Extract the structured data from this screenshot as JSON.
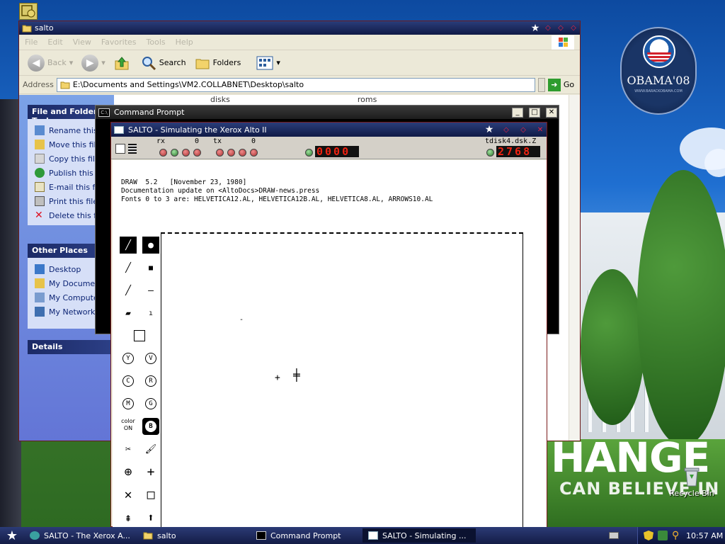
{
  "explorer": {
    "title": "salto",
    "menu": [
      "File",
      "Edit",
      "View",
      "Favorites",
      "Tools",
      "Help"
    ],
    "toolbar": {
      "back": "Back",
      "search": "Search",
      "folders": "Folders"
    },
    "address_label": "Address",
    "address_value": "E:\\Documents and Settings\\VM2.COLLABNET\\Desktop\\salto",
    "go_label": "Go",
    "file_tasks": {
      "header": "File and Folder Tasks",
      "items": [
        "Rename this file",
        "Move this file",
        "Copy this file",
        "Publish this file",
        "E-mail this file",
        "Print this file",
        "Delete this file"
      ]
    },
    "other_places": {
      "header": "Other Places",
      "items": [
        "Desktop",
        "My Documents",
        "My Computer",
        "My Network Places"
      ]
    },
    "details_header": "Details",
    "folders_visible": [
      "disks",
      "roms"
    ]
  },
  "cmd": {
    "title": "Command Prompt",
    "icon_text": "C:\\"
  },
  "salto": {
    "title": "SALTO - Simulating the Xerox Alto II",
    "rx_label": "rx",
    "rx_count": "0",
    "tx_label": "tx",
    "tx_count": "0",
    "counter": "0000",
    "disk_label": "tdisk4.dsk.Z",
    "disk_counter": "2768",
    "screen_text": "DRAW  5.2   [November 23, 1980]\nDocumentation update on <AltoDocs>DRAW-news.press\nFonts 0 to 3 are: HELVETICA12.AL, HELVETICA12B.AL, HELVETICA8.AL, ARROWS10.AL",
    "color_label_1": "color",
    "color_label_2": "ON",
    "circle_tools": [
      "Y",
      "V",
      "C",
      "R",
      "M",
      "G"
    ],
    "bold_tool": "B"
  },
  "desktop": {
    "badge_text": "OBAMA'08",
    "badge_sub": "WWW.BARACKOBAMA.COM",
    "change_text": "HANGE",
    "believe_text": "CAN BELIEVE IN",
    "recycle_bin": "Recycle Bin"
  },
  "taskbar": {
    "tasks": [
      "SALTO - The Xerox A...",
      "salto",
      "Command Prompt",
      "SALTO - Simulating ..."
    ],
    "clock": "10:57 AM"
  }
}
